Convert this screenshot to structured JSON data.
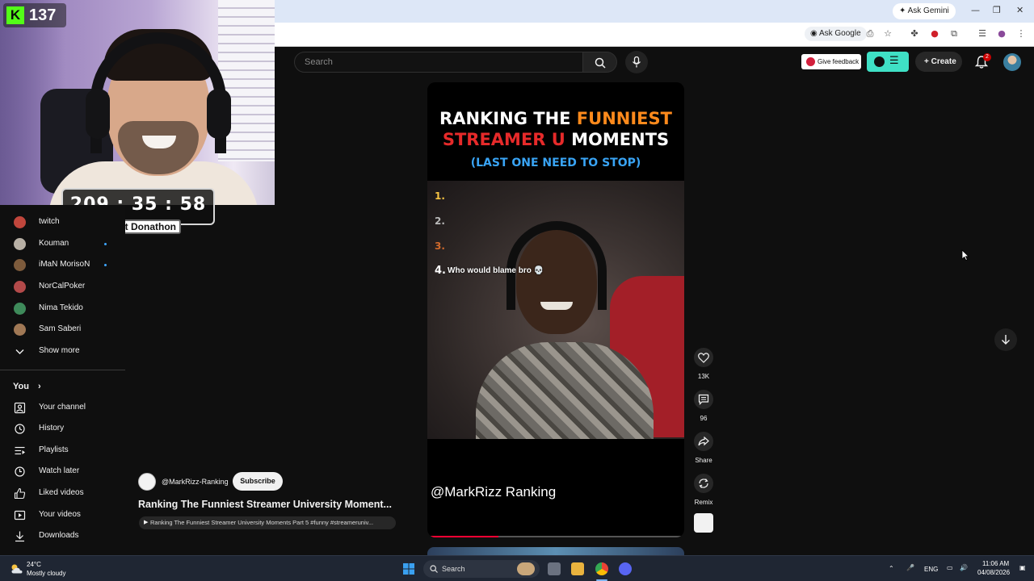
{
  "browser": {
    "ask_gemini": "Ask Gemini",
    "ask_google": "Ask Google"
  },
  "overlay": {
    "kick_count": "137",
    "timer": "209 : 35 : 58",
    "timer_label": "Silent Donathon"
  },
  "header": {
    "search_placeholder": "Search",
    "feedback": "Give feedback",
    "create": "Create",
    "notifications": "2"
  },
  "sidebar": {
    "subscriptions": [
      {
        "label": "twitch",
        "live": false,
        "color": "#c0463c"
      },
      {
        "label": "Kouman",
        "live": true,
        "color": "#b8b0a5"
      },
      {
        "label": "iMaN MorisoN",
        "live": true,
        "color": "#7d5b3c"
      },
      {
        "label": "NorCalPoker",
        "live": false,
        "color": "#b34a4a"
      },
      {
        "label": "Nima Tekido",
        "live": false,
        "color": "#3e8a5a"
      },
      {
        "label": "Sam Saberi",
        "live": false,
        "color": "#a07855"
      }
    ],
    "show_more": "Show more",
    "you_title": "You",
    "you_items": [
      {
        "label": "Your channel",
        "icon": "channel-icon"
      },
      {
        "label": "History",
        "icon": "history-icon"
      },
      {
        "label": "Playlists",
        "icon": "playlists-icon"
      },
      {
        "label": "Watch later",
        "icon": "clock-icon"
      },
      {
        "label": "Liked videos",
        "icon": "thumbs-up-icon"
      },
      {
        "label": "Your videos",
        "icon": "video-icon"
      },
      {
        "label": "Downloads",
        "icon": "download-icon"
      }
    ]
  },
  "video": {
    "channel": "@MarkRizz-Ranking",
    "subscribe": "Subscribe",
    "title": "Ranking The Funniest Streamer University Moment...",
    "pill": "Ranking The Funniest Streamer University Moments Part 5 #funny #streameruniv..."
  },
  "short": {
    "headline_1a": "RANKING THE ",
    "headline_1b": "FUNNIEST",
    "headline_2a": "STREAMER U",
    "headline_2b": " MOMENTS",
    "headline_3": "(LAST ONE NEED TO STOP)",
    "ranks": [
      "1.",
      "2.",
      "3.",
      "4."
    ],
    "rank_4_text": "Who would blame bro 💀",
    "watermark": "@MarkRizz Ranking",
    "progress": 0.27
  },
  "actions": {
    "likes": "13K",
    "comments": "96",
    "share": "Share",
    "remix": "Remix"
  },
  "taskbar": {
    "temp": "24°C",
    "condition": "Mostly cloudy",
    "search": "Search",
    "lang": "ENG",
    "time": "11:06 AM",
    "date": "04/08/2026"
  }
}
